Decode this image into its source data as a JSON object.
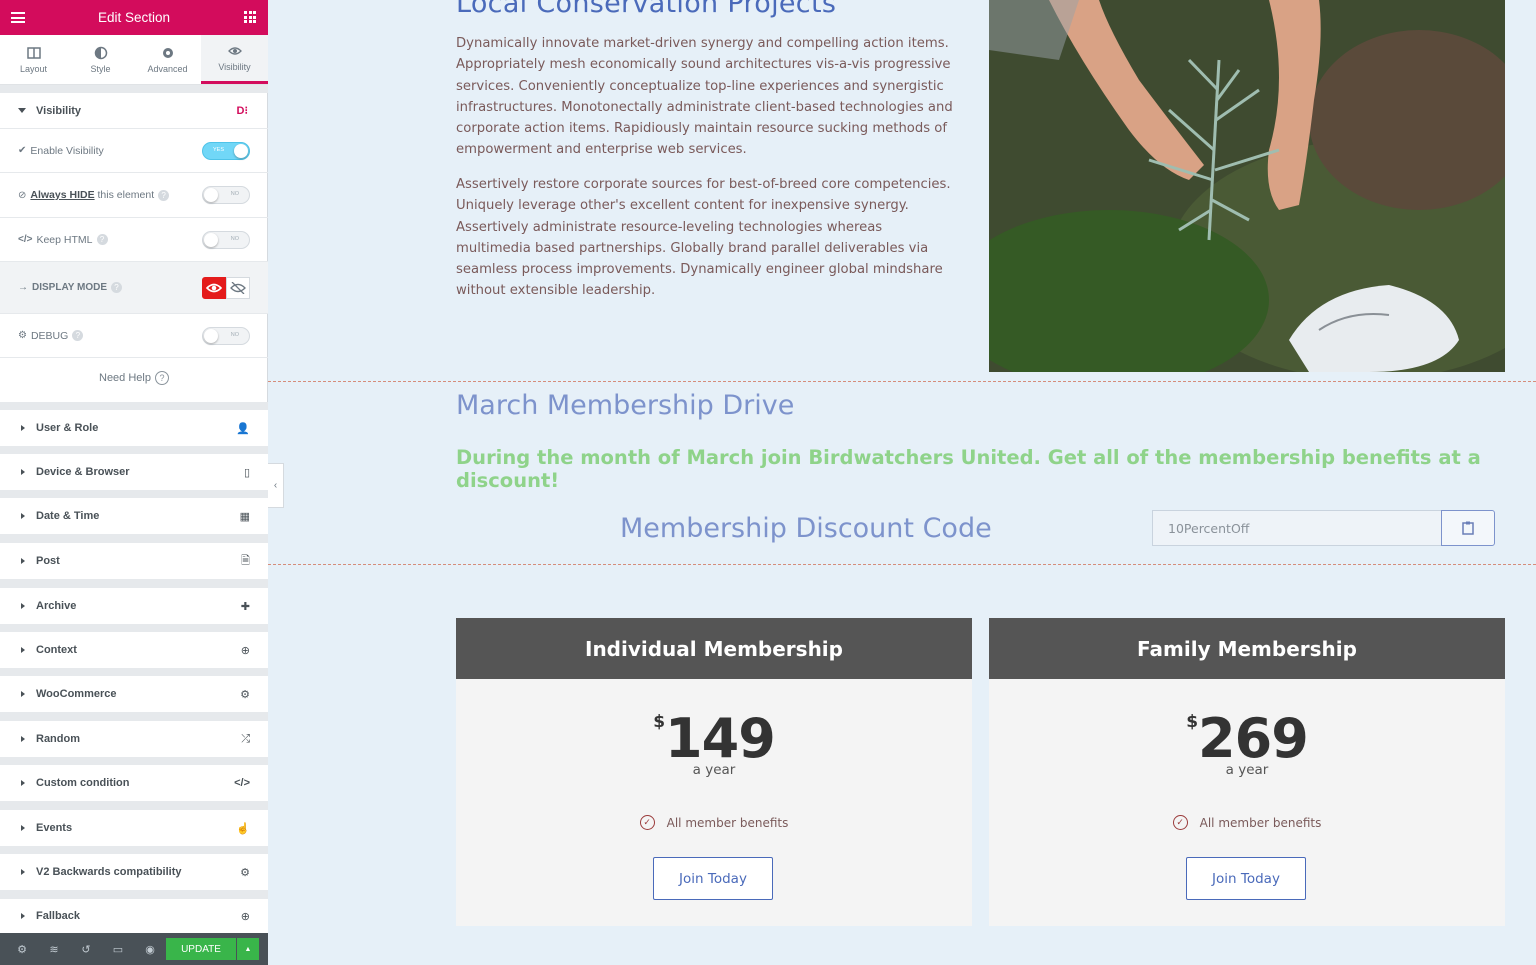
{
  "panel": {
    "title": "Edit Section",
    "tabs": [
      {
        "label": "Layout",
        "icon": "layout-icon"
      },
      {
        "label": "Style",
        "icon": "style-icon"
      },
      {
        "label": "Advanced",
        "icon": "gear-icon"
      },
      {
        "label": "Visibility",
        "icon": "eye-icon"
      }
    ],
    "visibility": {
      "heading": "Visibility",
      "enable": {
        "label": "Enable Visibility",
        "value": "YES"
      },
      "always_hide": {
        "label_strong": "Always HIDE",
        "label_rest": "this element",
        "value": "NO"
      },
      "keep_html": {
        "label": "Keep HTML",
        "value": "NO"
      },
      "display_mode": {
        "label": "DISPLAY MODE"
      },
      "debug": {
        "label": "DEBUG",
        "value": "NO"
      },
      "need_help": "Need Help"
    },
    "sections": [
      {
        "label": "User & Role",
        "icon": "user-icon"
      },
      {
        "label": "Device & Browser",
        "icon": "mobile-icon"
      },
      {
        "label": "Date & Time",
        "icon": "calendar-icon"
      },
      {
        "label": "Post",
        "icon": "document-icon"
      },
      {
        "label": "Archive",
        "icon": "puzzle-icon"
      },
      {
        "label": "Context",
        "icon": "crosshair-icon"
      },
      {
        "label": "WooCommerce",
        "icon": "cog-icon"
      },
      {
        "label": "Random",
        "icon": "shuffle-icon"
      },
      {
        "label": "Custom condition",
        "icon": "code-icon"
      },
      {
        "label": "Events",
        "icon": "pointer-icon"
      },
      {
        "label": "V2 Backwards compatibility",
        "icon": "cog-icon"
      },
      {
        "label": "Fallback",
        "icon": "globe-icon"
      }
    ],
    "footer": {
      "update_label": "UPDATE"
    },
    "accent": "#d30c5c"
  },
  "page": {
    "conservation_title": "Local Conservation Projects",
    "para1": "Dynamically innovate market-driven synergy and compelling action items. Appropriately mesh economically sound architectures vis-a-vis progressive services. Conveniently conceptualize top-line experiences and synergistic infrastructures. Monotonectally administrate client-based technologies and corporate action items. Rapidiously maintain resource sucking methods of empowerment and enterprise web services.",
    "para2": "Assertively restore corporate sources for best-of-breed core competencies. Uniquely leverage other's excellent content for inexpensive synergy. Assertively administrate resource-leveling technologies whereas multimedia based partnerships. Globally brand parallel deliverables via seamless process improvements. Dynamically engineer global mindshare without extensible leadership.",
    "march_title": "March Membership Drive",
    "march_subtitle": "During the month of March join Birdwatchers United.  Get all of the membership benefits at a discount!",
    "discount_title": "Membership Discount Code",
    "discount_code": "10PercentOff",
    "plans": [
      {
        "name": "Individual Membership",
        "currency": "$",
        "price": "149",
        "period": "a year",
        "feature": "All member benefits",
        "cta": "Join Today"
      },
      {
        "name": "Family Membership",
        "currency": "$",
        "price": "269",
        "period": "a year",
        "feature": "All member benefits",
        "cta": "Join Today"
      }
    ]
  }
}
